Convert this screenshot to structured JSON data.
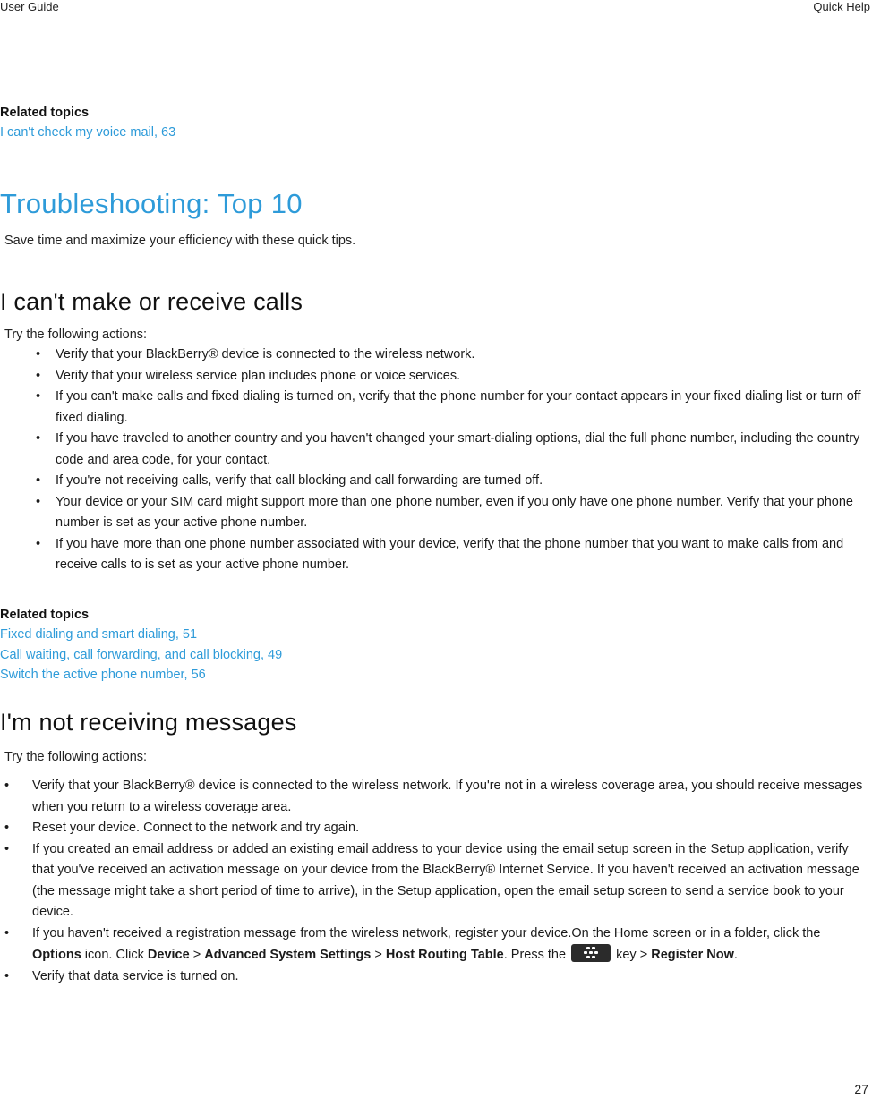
{
  "header": {
    "left": "User Guide",
    "right": "Quick Help"
  },
  "page_number": "27",
  "related_top": {
    "title": "Related topics",
    "links": [
      "I can't check my voice mail, 63"
    ]
  },
  "troubleshooting": {
    "title": "Troubleshooting: Top 10",
    "intro": "Save time and maximize your efficiency with these quick tips."
  },
  "calls": {
    "title": "I can't make or receive calls",
    "intro": "Try the following actions:",
    "items": [
      "Verify that your BlackBerry® device is connected to the wireless network.",
      "Verify that your wireless service plan includes phone or voice services.",
      "If you can't make calls and fixed dialing is turned on, verify that the phone number for your contact appears in your fixed dialing list or turn off fixed dialing.",
      "If you have traveled to another country and you haven't changed your smart-dialing options, dial the full phone number, including the country code and area code, for your contact.",
      "If you're not receiving calls, verify that call blocking and call forwarding are turned off.",
      "Your device or your SIM card might support more than one phone number, even if you only have one phone number. Verify that your phone number is set as your active phone number.",
      "If you have more than one phone number associated with your device, verify that the phone number that you want to make calls from and receive calls to is set as your active phone number."
    ],
    "related_title": "Related topics",
    "related_links": [
      "Fixed dialing and smart dialing, 51",
      "Call waiting, call forwarding, and call blocking, 49",
      "Switch the active phone number, 56"
    ]
  },
  "messages": {
    "title": "I'm not receiving messages",
    "intro": "Try the following actions:",
    "items": [
      "Verify that your BlackBerry® device is connected to the wireless network. If you're not in a wireless coverage area, you should receive messages when you return to a wireless coverage area.",
      "Reset your device. Connect to the network and try again.",
      "If you created an email address or added an existing email address to your device using the email setup screen in the Setup application, verify that you've received an activation message on your device from the BlackBerry® Internet Service. If you haven't received an activation message (the message might take a short period of time to arrive), in the Setup application, open the email setup screen to send a service book to your device."
    ],
    "registration": {
      "text1": "If you haven't received a registration message from the wireless network, register your device.On the Home screen or in a folder, click the ",
      "options": "Options",
      "text2": " icon. Click ",
      "device": "Device",
      "sep1": " > ",
      "advanced": "Advanced System Settings",
      "sep2": " > ",
      "host": "Host Routing Table",
      "text3": ". Press the ",
      "key_icon": "blackberry-menu-key-icon",
      "text4": " key > ",
      "register": "Register Now",
      "text5": "."
    },
    "last_item": "Verify that data service is turned on."
  },
  "colors": {
    "accent": "#2e9bd9",
    "text": "#1a1a1a",
    "key_bg": "#2b2b2b"
  }
}
